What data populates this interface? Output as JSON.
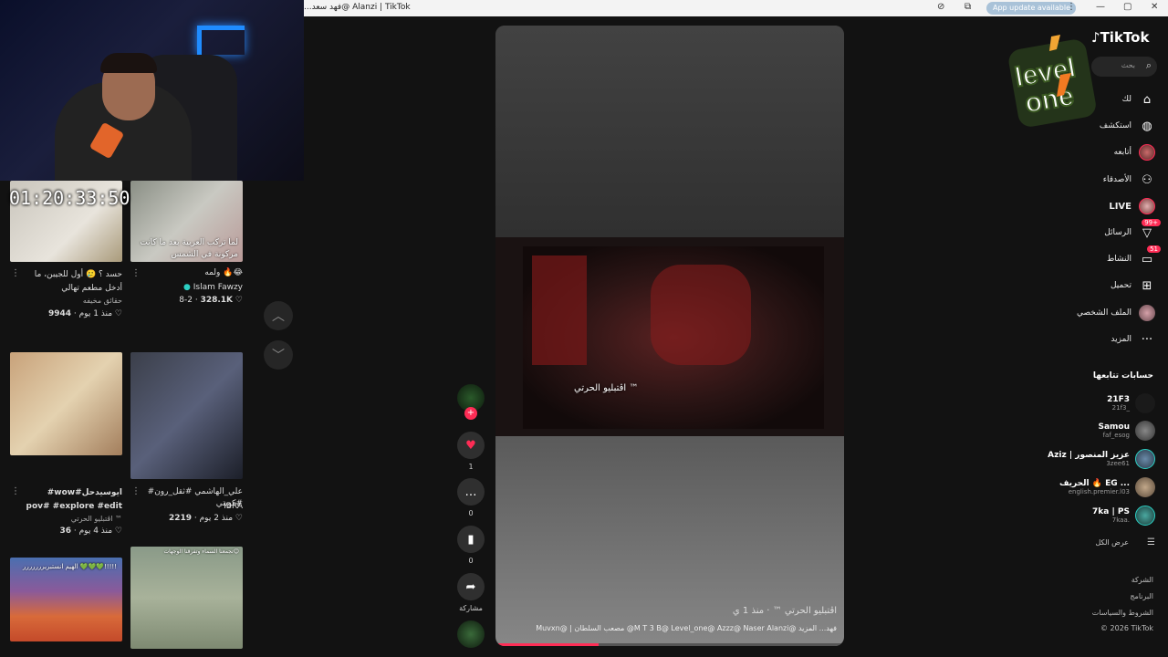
{
  "browser": {
    "title": "...فهد سعد@ Alanzi | TikTok",
    "update": "App update available"
  },
  "overlay": {
    "timer": "01:20:33:50"
  },
  "grid": {
    "cards": [
      {
        "title": "حسد ؟ 🥲 أول للجيبن، ما أدخل مطعم تهالي",
        "author": "حقائق مخيفه",
        "likes": "9944",
        "date": "منذ 1 يوم"
      },
      {
        "title": "ولمه 🔥😂",
        "author": "Islam Fawzy",
        "likes": "328.1K",
        "date": "8-2",
        "overlay": "لما تركب العربية بعد ما كانت مركونة في الشمس"
      },
      {
        "title": "#wow#ايوسيدحل pov# #explore #edit",
        "author": "اڤتبليو الحرتي ™",
        "likes": "36",
        "date": "منذ 4 يوم"
      },
      {
        "title": "#علي_الهاشمي #ثقل_رون #كويتي",
        "author": "IBRA",
        "likes": "2219",
        "date": "منذ 2 يوم"
      },
      {
        "overlay": "الهيم انستبريررررررر 💚💚💚!!!!!"
      },
      {
        "overlay": "تجمعنا السماء وتفرقنا الوجهات😊"
      }
    ]
  },
  "video": {
    "caption": "اڤتبليو الحرتي ™",
    "meta": "اڤتبليو الحرتي ™ · منذ 1 ي",
    "description": "Muvxn@ | مصعب السلطان @M T 3 B@ Level_one@ Azzz@ Naser Alanzi@ فهد... المزيد"
  },
  "actions": {
    "likes": "1",
    "comments": "0",
    "saves": "0",
    "share": "مشاركة"
  },
  "sidebar": {
    "brand": "TikTok",
    "search_placeholder": "بحث",
    "nav": [
      {
        "label": "لك",
        "icon": "home-icon"
      },
      {
        "label": "استكشف",
        "icon": "compass-icon"
      },
      {
        "label": "أتابعه",
        "icon": "avatar"
      },
      {
        "label": "الأصدقاء",
        "icon": "friends-icon"
      },
      {
        "label": "LIVE",
        "icon": "live-icon"
      },
      {
        "label": "الرسائل",
        "icon": "messages-icon",
        "badge": "99+"
      },
      {
        "label": "النشاط",
        "icon": "activity-icon",
        "badge": "51"
      },
      {
        "label": "تحميل",
        "icon": "upload-icon"
      },
      {
        "label": "الملف الشخصي",
        "icon": "profile-icon"
      },
      {
        "label": "المزيد",
        "icon": "more-icon"
      }
    ],
    "following_title": "حسابات تتابعها",
    "accounts": [
      {
        "name": "21F3",
        "user": "21f3_"
      },
      {
        "name": "Samou",
        "user": "faf_esog"
      },
      {
        "name": "Aziz | عزيز المنصور",
        "user": "3zee61"
      },
      {
        "name": "الحريف 🔥 EG ...",
        "user": "english.premier.l03"
      },
      {
        "name": "7ka | PS",
        "user": "7kaa."
      }
    ],
    "show_all": "عرض الكل",
    "footer": [
      "الشركة",
      "البرنامج",
      "الشروط والسياسات",
      "© 2026 TikTok"
    ]
  },
  "colors": {
    "accent": "#fe2c55",
    "bg": "#121212"
  }
}
